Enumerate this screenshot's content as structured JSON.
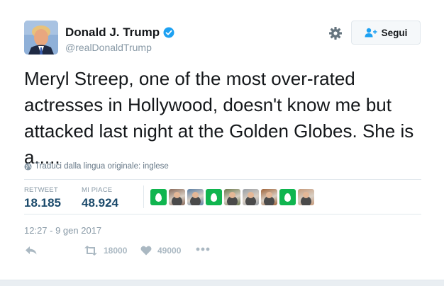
{
  "author": {
    "name": "Donald J. Trump",
    "handle": "@realDonaldTrump",
    "verified": true,
    "avatar_icon": "profile-photo"
  },
  "header": {
    "settings_icon": "gear-icon",
    "follow_label": "Segui",
    "follow_icon": "add-user-icon"
  },
  "tweet": {
    "text": "Meryl Streep, one of the most over-rated actresses in Hollywood, doesn't know me but attacked last night at the Golden Globes. She is a.....",
    "translate_label": "Traduci dalla lingua originale: inglese",
    "timestamp": "12:27 - 9 gen 2017"
  },
  "stats": {
    "retweet_label": "RETWEET",
    "retweet_count": "18.185",
    "likes_label": "MI PIACE",
    "likes_count": "48.924"
  },
  "likers": [
    {
      "type": "egg"
    },
    {
      "type": "photo",
      "color": "#8a6a5a"
    },
    {
      "type": "photo",
      "color": "#5b7fa5"
    },
    {
      "type": "egg"
    },
    {
      "type": "photo",
      "color": "#6b7a4e"
    },
    {
      "type": "photo",
      "color": "#9aa0a6"
    },
    {
      "type": "photo",
      "color": "#a0643a"
    },
    {
      "type": "egg"
    },
    {
      "type": "photo",
      "color": "#c79a7a"
    }
  ],
  "actions": {
    "reply_icon": "reply-icon",
    "retweet_icon": "retweet-icon",
    "retweet_count": "18000",
    "like_icon": "heart-icon",
    "like_count": "49000",
    "more_icon": "more-icon"
  },
  "colors": {
    "text": "#14171a",
    "muted": "#8899a6",
    "stat_value": "#1b4a6b",
    "verified_blue": "#1da1f2",
    "egg_green": "#10b54f"
  }
}
